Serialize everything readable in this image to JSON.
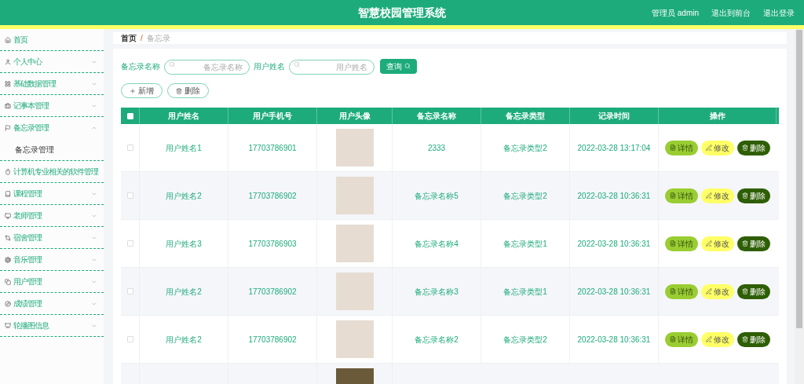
{
  "header": {
    "title": "智慧校园管理系统",
    "links": [
      "管理员 admin",
      "退出到前台",
      "退出登录"
    ]
  },
  "sidebar": {
    "items": [
      {
        "label": "首页"
      },
      {
        "label": "个人中心",
        "expanded": false
      },
      {
        "label": "基础数据管理",
        "expanded": false
      },
      {
        "label": "记事本管理",
        "expanded": false
      },
      {
        "label": "备忘录管理",
        "expanded": true,
        "children": [
          {
            "label": "备忘录管理"
          }
        ]
      },
      {
        "label": "计算机专业相关的软件管理"
      },
      {
        "label": "课程管理",
        "expanded": false
      },
      {
        "label": "老师管理",
        "expanded": false
      },
      {
        "label": "宿舍管理",
        "expanded": false
      },
      {
        "label": "音乐管理",
        "expanded": false
      },
      {
        "label": "用户管理",
        "expanded": false
      },
      {
        "label": "成绩管理",
        "expanded": false
      },
      {
        "label": "轮播图信息",
        "expanded": false
      }
    ]
  },
  "breadcrumb": {
    "items": [
      "首页",
      "备忘录"
    ],
    "separator": "/"
  },
  "search": {
    "fields": [
      {
        "label": "备忘录名称",
        "placeholder": "备忘录名称"
      },
      {
        "label": "用户姓名",
        "placeholder": "用户姓名"
      }
    ],
    "button": "查询"
  },
  "actions": [
    {
      "label": "新增",
      "kind": "add"
    },
    {
      "label": "删除",
      "kind": "delete"
    }
  ],
  "table": {
    "select_all_checked": false,
    "columns": [
      "用户姓名",
      "用户手机号",
      "用户头像",
      "备忘录名称",
      "备忘录类型",
      "记录时间",
      "操作"
    ],
    "rows": [
      {
        "checked": false,
        "name": "用户姓名1",
        "phone": "17703786901",
        "memo": "2333",
        "type": "备忘录类型2",
        "time": "2022-03-28 13:17:04",
        "actions": [
          {
            "label": "详情",
            "kind": "detail"
          },
          {
            "label": "修改",
            "kind": "edit"
          },
          {
            "label": "删除",
            "kind": "delete"
          }
        ]
      },
      {
        "checked": false,
        "name": "用户姓名2",
        "phone": "17703786902",
        "memo": "备忘录名称5",
        "type": "备忘录类型2",
        "time": "2022-03-28 10:36:31",
        "actions": [
          {
            "label": "详情",
            "kind": "detail"
          },
          {
            "label": "修改",
            "kind": "edit"
          },
          {
            "label": "删除",
            "kind": "delete"
          }
        ]
      },
      {
        "checked": false,
        "name": "用户姓名3",
        "phone": "17703786903",
        "memo": "备忘录名称4",
        "type": "备忘录类型1",
        "time": "2022-03-28 10:36:31",
        "actions": [
          {
            "label": "详情",
            "kind": "detail"
          },
          {
            "label": "修改",
            "kind": "edit"
          },
          {
            "label": "删除",
            "kind": "delete"
          }
        ]
      },
      {
        "checked": false,
        "name": "用户姓名2",
        "phone": "17703786902",
        "memo": "备忘录名称3",
        "type": "备忘录类型1",
        "time": "2022-03-28 10:36:31",
        "actions": [
          {
            "label": "详情",
            "kind": "detail"
          },
          {
            "label": "修改",
            "kind": "edit"
          },
          {
            "label": "删除",
            "kind": "delete"
          }
        ]
      },
      {
        "checked": false,
        "name": "用户姓名2",
        "phone": "17703786902",
        "memo": "备忘录名称2",
        "type": "备忘录类型2",
        "time": "2022-03-28 10:36:31",
        "actions": [
          {
            "label": "详情",
            "kind": "detail"
          },
          {
            "label": "修改",
            "kind": "edit"
          },
          {
            "label": "删除",
            "kind": "delete"
          }
        ]
      }
    ]
  }
}
